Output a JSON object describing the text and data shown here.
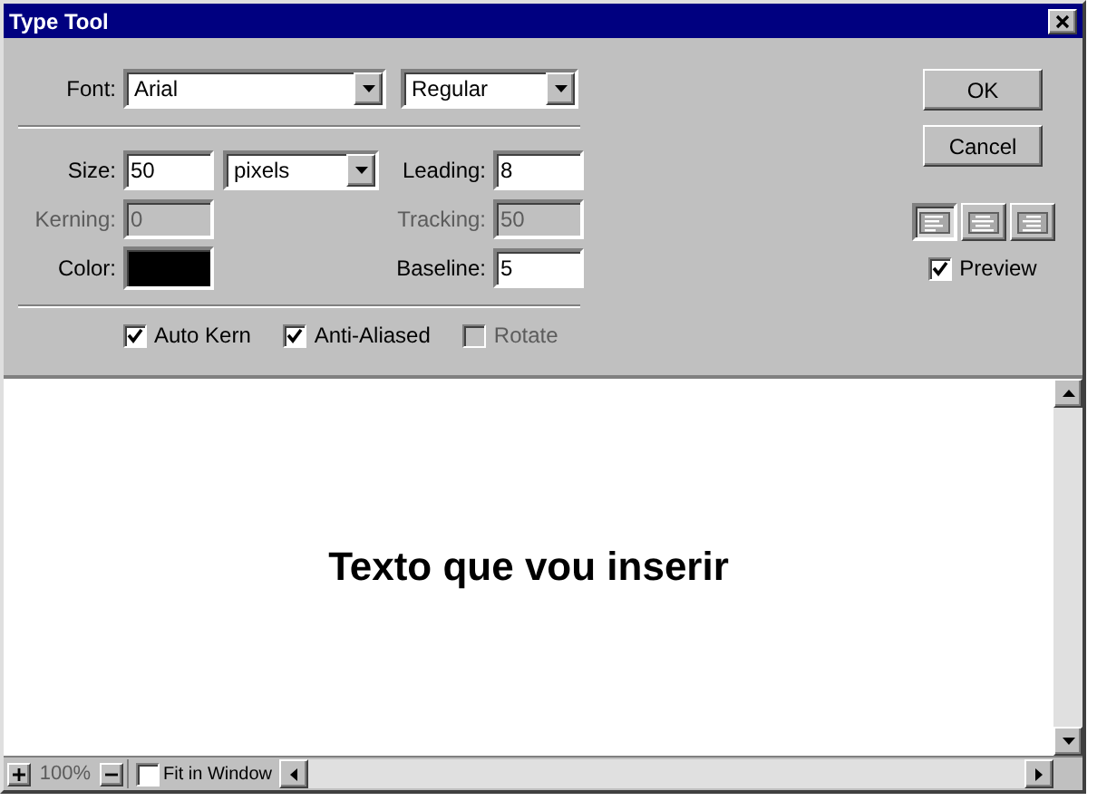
{
  "window": {
    "title": "Type Tool"
  },
  "font": {
    "label": "Font:",
    "family": "Arial",
    "style": "Regular"
  },
  "size": {
    "label": "Size:",
    "value": "50",
    "unit": "pixels",
    "disabled": false
  },
  "leading": {
    "label": "Leading:",
    "value": "8",
    "disabled": false
  },
  "kerning": {
    "label": "Kerning:",
    "value": "0",
    "disabled": true
  },
  "tracking": {
    "label": "Tracking:",
    "value": "50",
    "disabled": true
  },
  "color": {
    "label": "Color:",
    "color": "#000000"
  },
  "baseline": {
    "label": "Baseline:",
    "value": "5",
    "disabled": false
  },
  "options": [
    {
      "label": "Auto Kern",
      "checked": true,
      "disabled": false
    },
    {
      "label": "Anti-Aliased",
      "checked": true,
      "disabled": false
    },
    {
      "label": "Rotate",
      "checked": false,
      "disabled": true
    }
  ],
  "buttons": [
    "OK",
    "Cancel"
  ],
  "alignment": [
    {
      "kind": "left",
      "selected": true
    },
    {
      "kind": "center",
      "selected": false
    },
    {
      "kind": "right",
      "selected": false
    }
  ],
  "preview": {
    "label": "Preview",
    "checked": true
  },
  "preview_text": "Texto que vou inserir",
  "status_bar": {
    "zoom": "100%",
    "zoom_disabled": true,
    "fit": {
      "label": "Fit in Window",
      "checked": false
    }
  }
}
